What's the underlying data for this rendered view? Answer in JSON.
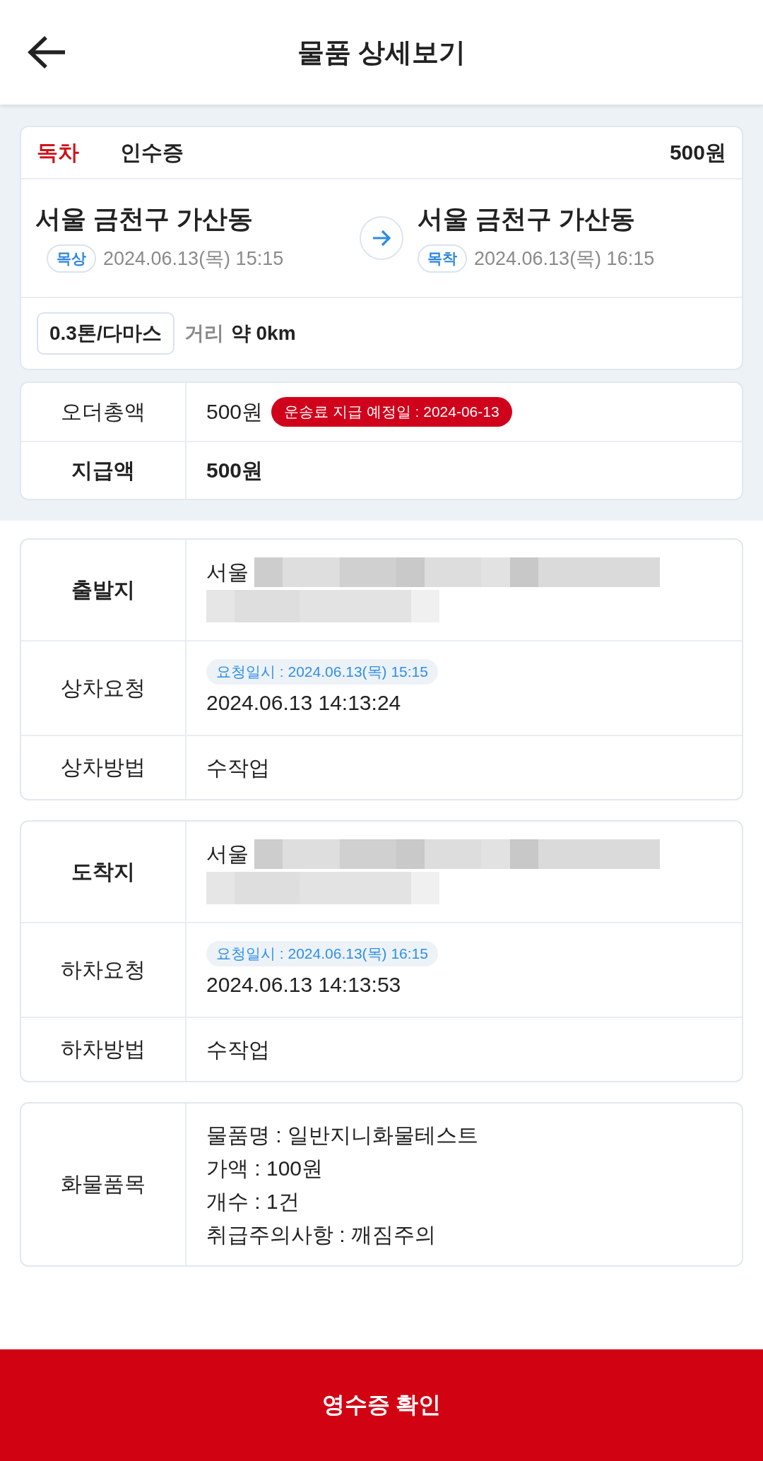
{
  "header": {
    "title": "물품 상세보기"
  },
  "summary": {
    "service_type": "독차",
    "document_type": "인수증",
    "price": "500원",
    "origin": {
      "place": "서울 금천구 가산동",
      "tag": "목상",
      "datetime": "2024.06.13(목) 15:15"
    },
    "destination": {
      "place": "서울 금천구 가산동",
      "tag": "목착",
      "datetime": "2024.06.13(목) 16:15"
    },
    "vehicle": "0.3톤/다마스",
    "distance_label": "거리",
    "distance": "약 0km"
  },
  "payment": {
    "rows": [
      {
        "label": "오더총액",
        "value": "500원",
        "badge": "운송료 지급 예정일 : 2024-06-13",
        "emphasis": false
      },
      {
        "label": "지급액",
        "value": "500원",
        "emphasis": true
      }
    ]
  },
  "sections": [
    {
      "rows": [
        {
          "kind": "address",
          "label": "출발지",
          "value": "서울",
          "emphasis": true
        },
        {
          "kind": "request",
          "label": "상차요청",
          "badge": "요청일시 : 2024.06.13(목) 15:15",
          "value": "2024.06.13 14:13:24",
          "emphasis": false
        },
        {
          "kind": "text",
          "label": "상차방법",
          "value": "수작업",
          "emphasis": false
        }
      ]
    },
    {
      "rows": [
        {
          "kind": "address",
          "label": "도착지",
          "value": "서울",
          "emphasis": true
        },
        {
          "kind": "request",
          "label": "하차요청",
          "badge": "요청일시 : 2024.06.13(목) 16:15",
          "value": "2024.06.13 14:13:53",
          "emphasis": false
        },
        {
          "kind": "text",
          "label": "하차방법",
          "value": "수작업",
          "emphasis": false
        }
      ]
    },
    {
      "rows": [
        {
          "kind": "lines",
          "label": "화물품목",
          "lines": [
            "물품명 : 일반지니화물테스트",
            "가액 : 100원",
            "개수 : 1건",
            "취급주의사항 : 깨짐주의"
          ],
          "emphasis": false
        }
      ]
    }
  ],
  "footer": {
    "button": "영수증 확인"
  }
}
